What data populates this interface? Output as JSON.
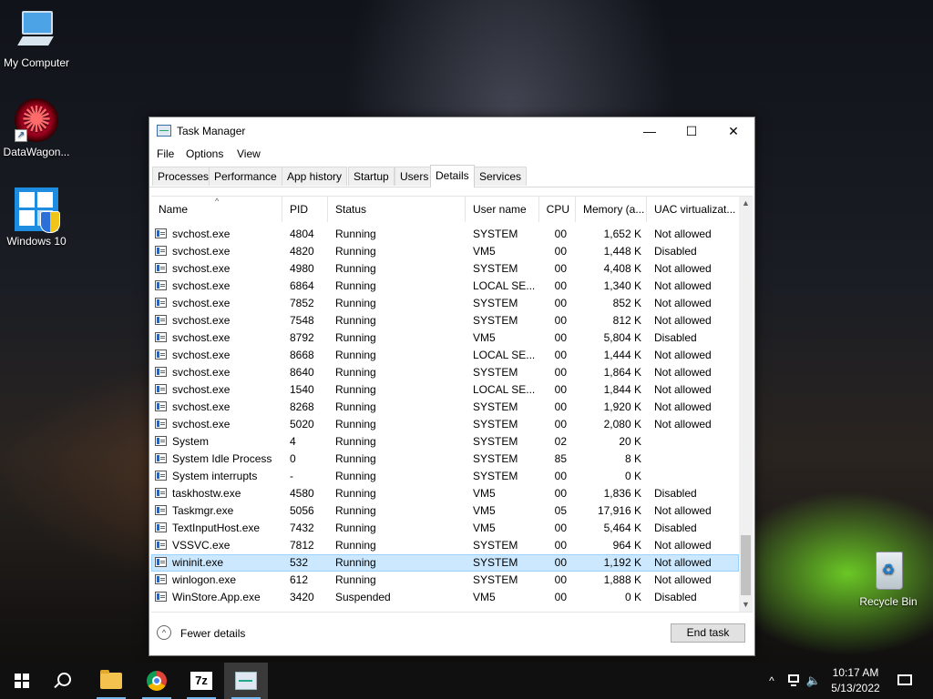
{
  "desktop": {
    "icons": [
      {
        "label": "My Computer"
      },
      {
        "label": "DataWagon..."
      },
      {
        "label": "Windows 10"
      },
      {
        "label": "Recycle Bin"
      }
    ]
  },
  "window": {
    "title": "Task Manager",
    "controls": {
      "minimize": "—",
      "maximize": "☐",
      "close": "✕"
    },
    "menu": [
      "File",
      "Options",
      "View"
    ],
    "tabs": [
      "Processes",
      "Performance",
      "App history",
      "Startup",
      "Users",
      "Details",
      "Services"
    ],
    "active_tab": "Details",
    "columns": [
      "Name",
      "PID",
      "Status",
      "User name",
      "CPU",
      "Memory (a...",
      "UAC virtualizat..."
    ],
    "rows": [
      {
        "name": "svchost.exe",
        "pid": "4804",
        "status": "Running",
        "user": "SYSTEM",
        "cpu": "00",
        "memory": "1,652 K",
        "uac": "Not allowed"
      },
      {
        "name": "svchost.exe",
        "pid": "4820",
        "status": "Running",
        "user": "VM5",
        "cpu": "00",
        "memory": "1,448 K",
        "uac": "Disabled"
      },
      {
        "name": "svchost.exe",
        "pid": "4980",
        "status": "Running",
        "user": "SYSTEM",
        "cpu": "00",
        "memory": "4,408 K",
        "uac": "Not allowed"
      },
      {
        "name": "svchost.exe",
        "pid": "6864",
        "status": "Running",
        "user": "LOCAL SE...",
        "cpu": "00",
        "memory": "1,340 K",
        "uac": "Not allowed"
      },
      {
        "name": "svchost.exe",
        "pid": "7852",
        "status": "Running",
        "user": "SYSTEM",
        "cpu": "00",
        "memory": "852 K",
        "uac": "Not allowed"
      },
      {
        "name": "svchost.exe",
        "pid": "7548",
        "status": "Running",
        "user": "SYSTEM",
        "cpu": "00",
        "memory": "812 K",
        "uac": "Not allowed"
      },
      {
        "name": "svchost.exe",
        "pid": "8792",
        "status": "Running",
        "user": "VM5",
        "cpu": "00",
        "memory": "5,804 K",
        "uac": "Disabled"
      },
      {
        "name": "svchost.exe",
        "pid": "8668",
        "status": "Running",
        "user": "LOCAL SE...",
        "cpu": "00",
        "memory": "1,444 K",
        "uac": "Not allowed"
      },
      {
        "name": "svchost.exe",
        "pid": "8640",
        "status": "Running",
        "user": "SYSTEM",
        "cpu": "00",
        "memory": "1,864 K",
        "uac": "Not allowed"
      },
      {
        "name": "svchost.exe",
        "pid": "1540",
        "status": "Running",
        "user": "LOCAL SE...",
        "cpu": "00",
        "memory": "1,844 K",
        "uac": "Not allowed"
      },
      {
        "name": "svchost.exe",
        "pid": "8268",
        "status": "Running",
        "user": "SYSTEM",
        "cpu": "00",
        "memory": "1,920 K",
        "uac": "Not allowed"
      },
      {
        "name": "svchost.exe",
        "pid": "5020",
        "status": "Running",
        "user": "SYSTEM",
        "cpu": "00",
        "memory": "2,080 K",
        "uac": "Not allowed"
      },
      {
        "name": "System",
        "pid": "4",
        "status": "Running",
        "user": "SYSTEM",
        "cpu": "02",
        "memory": "20 K",
        "uac": ""
      },
      {
        "name": "System Idle Process",
        "pid": "0",
        "status": "Running",
        "user": "SYSTEM",
        "cpu": "85",
        "memory": "8 K",
        "uac": ""
      },
      {
        "name": "System interrupts",
        "pid": "-",
        "status": "Running",
        "user": "SYSTEM",
        "cpu": "00",
        "memory": "0 K",
        "uac": ""
      },
      {
        "name": "taskhostw.exe",
        "pid": "4580",
        "status": "Running",
        "user": "VM5",
        "cpu": "00",
        "memory": "1,836 K",
        "uac": "Disabled"
      },
      {
        "name": "Taskmgr.exe",
        "pid": "5056",
        "status": "Running",
        "user": "VM5",
        "cpu": "05",
        "memory": "17,916 K",
        "uac": "Not allowed"
      },
      {
        "name": "TextInputHost.exe",
        "pid": "7432",
        "status": "Running",
        "user": "VM5",
        "cpu": "00",
        "memory": "5,464 K",
        "uac": "Disabled"
      },
      {
        "name": "VSSVC.exe",
        "pid": "7812",
        "status": "Running",
        "user": "SYSTEM",
        "cpu": "00",
        "memory": "964 K",
        "uac": "Not allowed"
      },
      {
        "name": "wininit.exe",
        "pid": "532",
        "status": "Running",
        "user": "SYSTEM",
        "cpu": "00",
        "memory": "1,192 K",
        "uac": "Not allowed"
      },
      {
        "name": "winlogon.exe",
        "pid": "612",
        "status": "Running",
        "user": "SYSTEM",
        "cpu": "00",
        "memory": "1,888 K",
        "uac": "Not allowed"
      },
      {
        "name": "WinStore.App.exe",
        "pid": "3420",
        "status": "Suspended",
        "user": "VM5",
        "cpu": "00",
        "memory": "0 K",
        "uac": "Disabled"
      }
    ],
    "selected_row": "wininit.exe",
    "fewer_details": "Fewer details",
    "end_task": "End task"
  },
  "taskbar": {
    "apps": [
      "start-icon",
      "search-icon",
      "file-explorer-icon",
      "chrome-icon",
      "7zip-icon",
      "task-manager-icon"
    ],
    "sevenzip_label": "7z",
    "tray": {
      "chevron": "^",
      "time": "10:17 AM",
      "date": "5/13/2022"
    }
  }
}
